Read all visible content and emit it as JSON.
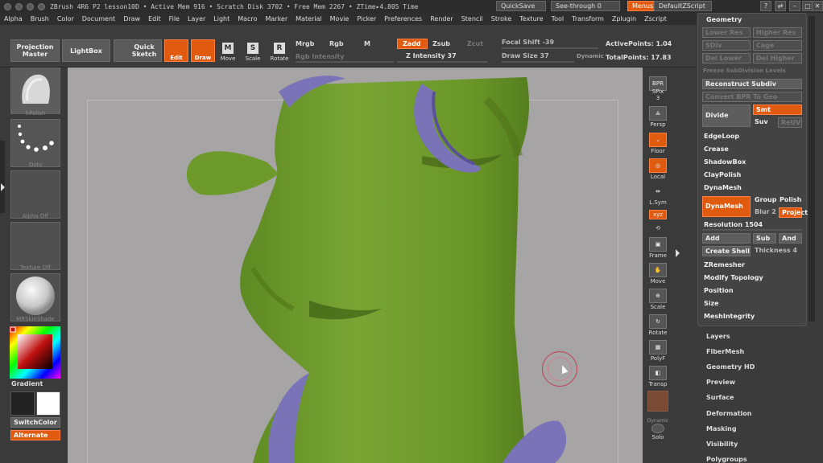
{
  "titlebar": {
    "text": "ZBrush 4R6 P2   lesson10D   • Active Mem 916 • Scratch Disk 3702 • Free Mem 2267 • ZTime▸4.805 Time",
    "quicksave": "QuickSave",
    "seethrough": "See-through",
    "seethrough_value": "0",
    "menus": "Menus",
    "script": "DefaultZScript"
  },
  "menu": [
    "Alpha",
    "Brush",
    "Color",
    "Document",
    "Draw",
    "Edit",
    "File",
    "Layer",
    "Light",
    "Macro",
    "Marker",
    "Material",
    "Movie",
    "Picker",
    "Preferences",
    "Render",
    "Stencil",
    "Stroke",
    "Texture",
    "Tool",
    "Transform",
    "Zplugin",
    "Zscript"
  ],
  "shelf": {
    "projection_master": "Projection Master",
    "lightbox": "LightBox",
    "quick_sketch": "Quick Sketch",
    "edit": "Edit",
    "draw": "Draw",
    "move": "Move",
    "scale": "Scale",
    "rotate": "Rotate",
    "mrgb": "Mrgb",
    "rgb": "Rgb",
    "m": "M",
    "rgb_intensity": "Rgb Intensity",
    "zadd": "Zadd",
    "zsub": "Zsub",
    "zcut": "Zcut",
    "z_intensity": "Z Intensity",
    "z_intensity_value": "37",
    "focal_shift": "Focal Shift",
    "focal_shift_value": "-39",
    "draw_size": "Draw Size",
    "draw_size_value": "37",
    "dynamic": "Dynamic",
    "active_points": "ActivePoints: 1.04",
    "total_points": "TotalPoints: 17.83"
  },
  "lefttray": {
    "brush_label": "hPolish",
    "stroke_label": "Dots",
    "alpha_label": "Alpha Off",
    "texture_label": "Texture Off",
    "material_label": "MRSkinShade",
    "gradient": "Gradient",
    "switchcolor": "SwitchColor",
    "alternate": "Alternate"
  },
  "rightcol": [
    "BPR",
    "SPix",
    "Persp",
    "Floor",
    "Local",
    "L.Sym",
    "xyz",
    "Frame",
    "Move",
    "Scale",
    "Rotate",
    "PolyF",
    "Transp",
    "Dynamic",
    "Solo"
  ],
  "rightcol_values": {
    "spix": "3"
  },
  "geometry": {
    "title": "Geometry",
    "lower_res": "Lower Res",
    "higher_res": "Higher Res",
    "del_lower": "Del Lower",
    "del_higher": "Del Higher",
    "sdiv": "SDiv",
    "cage": "Cage",
    "rstr": "Rstr",
    "freeze": "Freeze SubDivision Levels",
    "reconstruct": "Reconstruct Subdiv",
    "convert_bpr": "Convert BPR To Geo",
    "divide": "Divide",
    "smt": "Smt",
    "suv": "Suv",
    "rel": "ReUV",
    "edgeloop": "EdgeLoop",
    "crease": "Crease",
    "shadowbox": "ShadowBox",
    "claypolish": "ClayPolish",
    "dynamesh_section": "DynaMesh",
    "dynamesh_btn": "DynaMesh",
    "group": "Group",
    "polish": "Polish",
    "blur": "Blur",
    "blur_value": "2",
    "project": "Project",
    "resolution": "Resolution",
    "resolution_value": "1504",
    "add": "Add",
    "sub": "Sub",
    "and": "And",
    "create_shell": "Create Shell",
    "thickness": "Thickness",
    "thickness_value": "4",
    "zremesher": "ZRemesher",
    "modify_topology": "Modify Topology",
    "position": "Position",
    "size": "Size",
    "meshintegrity": "MeshIntegrity"
  },
  "subpalettes": [
    "Layers",
    "FiberMesh",
    "Geometry HD",
    "Preview",
    "Surface",
    "Deformation",
    "Masking",
    "Visibility",
    "Polygroups"
  ],
  "colors": {
    "accent": "#e05a10",
    "mesh_green": "#6f9a2c",
    "mesh_purple": "#7a73b8",
    "canvas_bg": "#a7a4a6"
  }
}
